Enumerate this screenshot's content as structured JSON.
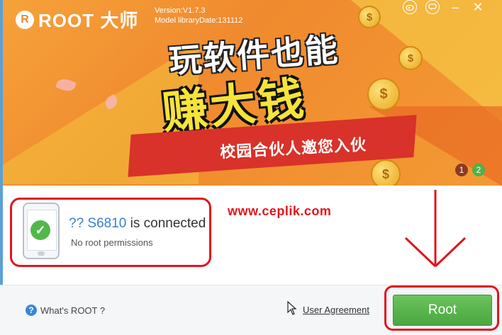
{
  "app": {
    "logo_letter": "R",
    "logo_text": "ROOT 大师",
    "version": "Version:V1.7.3",
    "model_library": "Model libraryDate:131112"
  },
  "titlebar": {
    "weibo_icon": "weibo-icon",
    "feedback_icon": "chat-bubble-icon",
    "minimize_label": "–",
    "close_label": "✕"
  },
  "banner": {
    "headline": "玩软件也能",
    "headline_big": "赚大钱",
    "ribbon_text": "校园合伙人邀您入伙",
    "coin_symbol": "$",
    "pages": [
      "1",
      "2"
    ],
    "active_page": 2
  },
  "device": {
    "name": "?? S6810",
    "connected_text": "is connected",
    "status": "No root permissions",
    "check_symbol": "✓"
  },
  "watermark": "www.ceplik.com",
  "footer": {
    "help_symbol": "?",
    "help_label": "What's ROOT ?",
    "agreement_label": "User Agreement",
    "root_button_label": "Root"
  },
  "colors": {
    "annotation_red": "#e3141b",
    "root_green": "#4aa73f",
    "banner_orange": "#f08a2e",
    "device_blue": "#3a7fd0"
  }
}
